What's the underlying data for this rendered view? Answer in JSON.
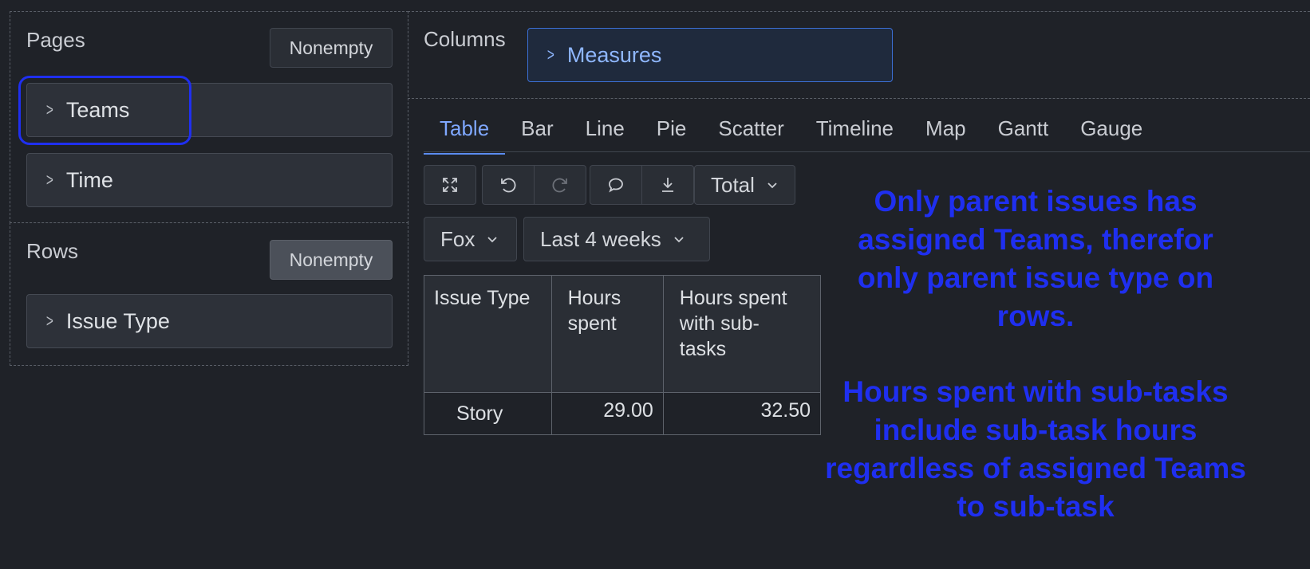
{
  "pages": {
    "label": "Pages",
    "nonempty_label": "Nonempty",
    "dimensions": [
      "Teams",
      "Time"
    ]
  },
  "rows": {
    "label": "Rows",
    "nonempty_label": "Nonempty",
    "dimensions": [
      "Issue Type"
    ]
  },
  "columns": {
    "label": "Columns",
    "dimensions": [
      "Measures"
    ]
  },
  "chart_tabs": [
    "Table",
    "Bar",
    "Line",
    "Pie",
    "Scatter",
    "Timeline",
    "Map",
    "Gantt",
    "Gauge"
  ],
  "active_tab": "Table",
  "toolbar": {
    "icons": [
      "fullscreen-icon",
      "undo-icon",
      "redo-icon",
      "comment-icon",
      "download-icon"
    ],
    "total_label": "Total"
  },
  "filters": {
    "team_value": "Fox",
    "period_value": "Last 4 weeks"
  },
  "table": {
    "headers": [
      "Issue Type",
      "Hours spent",
      "Hours spent with sub-tasks"
    ],
    "rows": [
      {
        "label": "Story",
        "hours_spent": "29.00",
        "hours_spent_with_subtasks": "32.50"
      }
    ]
  },
  "annotations": {
    "note1": "Only parent issues has assigned Teams, therefor only parent issue type on rows.",
    "note2": "Hours spent with sub-tasks include sub-task hours regardless of assigned Teams to sub-task"
  },
  "colors": {
    "background": "#1f2228",
    "accent": "#7fa8ff",
    "highlight_outline": "#1f2ff0",
    "annotation_text": "#1f2ff0"
  }
}
